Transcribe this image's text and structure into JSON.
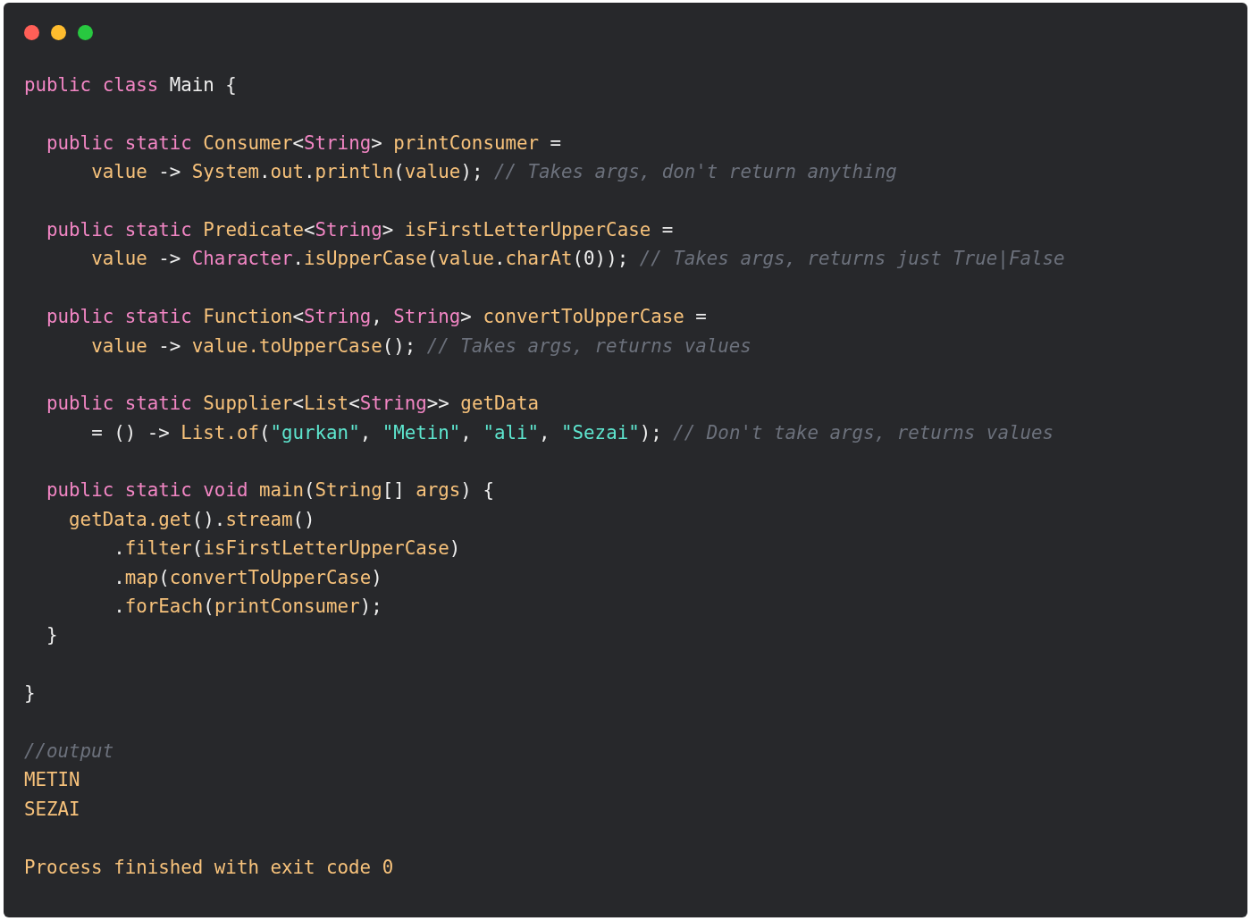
{
  "window": {
    "controls": [
      {
        "color": "#ff5f57"
      },
      {
        "color": "#febc2e"
      },
      {
        "color": "#28c840"
      }
    ]
  },
  "lines": [
    {
      "kind": "code",
      "tokens": [
        {
          "kind": "keyword",
          "text": "public class"
        },
        {
          "kind": "plain",
          "text": " Main {"
        }
      ]
    },
    {
      "kind": "blank"
    },
    {
      "kind": "code",
      "tokens": [
        {
          "kind": "keyword",
          "text": "  public static"
        },
        {
          "kind": "ident",
          "text": " Consumer"
        },
        {
          "kind": "plain",
          "text": "<"
        },
        {
          "kind": "keyword",
          "text": "String"
        },
        {
          "kind": "plain",
          "text": "> "
        },
        {
          "kind": "ident",
          "text": "printConsumer"
        },
        {
          "kind": "plain",
          "text": " ="
        }
      ]
    },
    {
      "kind": "code",
      "tokens": [
        {
          "kind": "ident",
          "text": "      value"
        },
        {
          "kind": "plain",
          "text": " -> "
        },
        {
          "kind": "ident",
          "text": "System"
        },
        {
          "kind": "plain",
          "text": "."
        },
        {
          "kind": "ident",
          "text": "out"
        },
        {
          "kind": "plain",
          "text": "."
        },
        {
          "kind": "ident",
          "text": "println"
        },
        {
          "kind": "plain",
          "text": "("
        },
        {
          "kind": "ident",
          "text": "value"
        },
        {
          "kind": "plain",
          "text": "); "
        },
        {
          "kind": "comment",
          "text": "// Takes args, don't return anything"
        }
      ]
    },
    {
      "kind": "blank"
    },
    {
      "kind": "code",
      "tokens": [
        {
          "kind": "keyword",
          "text": "  public static"
        },
        {
          "kind": "ident",
          "text": " Predicate"
        },
        {
          "kind": "plain",
          "text": "<"
        },
        {
          "kind": "keyword",
          "text": "String"
        },
        {
          "kind": "plain",
          "text": "> "
        },
        {
          "kind": "ident",
          "text": "isFirstLetterUpperCase"
        },
        {
          "kind": "plain",
          "text": " ="
        }
      ]
    },
    {
      "kind": "code",
      "tokens": [
        {
          "kind": "ident",
          "text": "      value"
        },
        {
          "kind": "plain",
          "text": " -> "
        },
        {
          "kind": "keyword",
          "text": "Character"
        },
        {
          "kind": "plain",
          "text": "."
        },
        {
          "kind": "ident",
          "text": "isUpperCase"
        },
        {
          "kind": "plain",
          "text": "("
        },
        {
          "kind": "ident",
          "text": "value"
        },
        {
          "kind": "plain",
          "text": "."
        },
        {
          "kind": "ident",
          "text": "charAt"
        },
        {
          "kind": "plain",
          "text": "(0)); "
        },
        {
          "kind": "comment",
          "text": "// Takes args, returns just True|False"
        }
      ]
    },
    {
      "kind": "blank"
    },
    {
      "kind": "code",
      "tokens": [
        {
          "kind": "keyword",
          "text": "  public static"
        },
        {
          "kind": "ident",
          "text": " Function"
        },
        {
          "kind": "plain",
          "text": "<"
        },
        {
          "kind": "keyword",
          "text": "String"
        },
        {
          "kind": "plain",
          "text": ", "
        },
        {
          "kind": "keyword",
          "text": "String"
        },
        {
          "kind": "plain",
          "text": "> "
        },
        {
          "kind": "ident",
          "text": "convertToUpperCase"
        },
        {
          "kind": "plain",
          "text": " ="
        }
      ]
    },
    {
      "kind": "code",
      "tokens": [
        {
          "kind": "ident",
          "text": "      value"
        },
        {
          "kind": "plain",
          "text": " -> "
        },
        {
          "kind": "ident",
          "text": "value.toUpperCase"
        },
        {
          "kind": "plain",
          "text": "(); "
        },
        {
          "kind": "comment",
          "text": "// Takes args, returns values"
        }
      ]
    },
    {
      "kind": "blank"
    },
    {
      "kind": "code",
      "tokens": [
        {
          "kind": "keyword",
          "text": "  public static"
        },
        {
          "kind": "ident",
          "text": " Supplier"
        },
        {
          "kind": "plain",
          "text": "<"
        },
        {
          "kind": "ident",
          "text": "List"
        },
        {
          "kind": "plain",
          "text": "<"
        },
        {
          "kind": "keyword",
          "text": "String"
        },
        {
          "kind": "plain",
          "text": ">> "
        },
        {
          "kind": "ident",
          "text": "getData"
        }
      ]
    },
    {
      "kind": "code",
      "tokens": [
        {
          "kind": "plain",
          "text": "      = () -> "
        },
        {
          "kind": "ident",
          "text": "List.of"
        },
        {
          "kind": "plain",
          "text": "("
        },
        {
          "kind": "string",
          "text": "\"gurkan\""
        },
        {
          "kind": "plain",
          "text": ", "
        },
        {
          "kind": "string",
          "text": "\"Metin\""
        },
        {
          "kind": "plain",
          "text": ", "
        },
        {
          "kind": "string",
          "text": "\"ali\""
        },
        {
          "kind": "plain",
          "text": ", "
        },
        {
          "kind": "string",
          "text": "\"Sezai\""
        },
        {
          "kind": "plain",
          "text": "); "
        },
        {
          "kind": "comment",
          "text": "// Don't take args, returns values"
        }
      ]
    },
    {
      "kind": "blank"
    },
    {
      "kind": "code",
      "tokens": [
        {
          "kind": "keyword",
          "text": "  public static void"
        },
        {
          "kind": "ident",
          "text": " main"
        },
        {
          "kind": "plain",
          "text": "("
        },
        {
          "kind": "ident",
          "text": "String"
        },
        {
          "kind": "plain",
          "text": "[] "
        },
        {
          "kind": "ident",
          "text": "args"
        },
        {
          "kind": "plain",
          "text": ") {"
        }
      ]
    },
    {
      "kind": "code",
      "tokens": [
        {
          "kind": "ident",
          "text": "    getData.get"
        },
        {
          "kind": "plain",
          "text": "()."
        },
        {
          "kind": "ident",
          "text": "stream"
        },
        {
          "kind": "plain",
          "text": "()"
        }
      ]
    },
    {
      "kind": "code",
      "tokens": [
        {
          "kind": "plain",
          "text": "        ."
        },
        {
          "kind": "ident",
          "text": "filter"
        },
        {
          "kind": "plain",
          "text": "("
        },
        {
          "kind": "ident",
          "text": "isFirstLetterUpperCase"
        },
        {
          "kind": "plain",
          "text": ")"
        }
      ]
    },
    {
      "kind": "code",
      "tokens": [
        {
          "kind": "plain",
          "text": "        ."
        },
        {
          "kind": "ident",
          "text": "map"
        },
        {
          "kind": "plain",
          "text": "("
        },
        {
          "kind": "ident",
          "text": "convertToUpperCase"
        },
        {
          "kind": "plain",
          "text": ")"
        }
      ]
    },
    {
      "kind": "code",
      "tokens": [
        {
          "kind": "plain",
          "text": "        ."
        },
        {
          "kind": "ident",
          "text": "forEach"
        },
        {
          "kind": "plain",
          "text": "("
        },
        {
          "kind": "ident",
          "text": "printConsumer"
        },
        {
          "kind": "plain",
          "text": ");"
        }
      ]
    },
    {
      "kind": "code",
      "tokens": [
        {
          "kind": "plain",
          "text": "  }"
        }
      ]
    },
    {
      "kind": "blank"
    },
    {
      "kind": "code",
      "tokens": [
        {
          "kind": "plain",
          "text": "}"
        }
      ]
    },
    {
      "kind": "blank"
    },
    {
      "kind": "code",
      "tokens": [
        {
          "kind": "comment",
          "text": "//output"
        }
      ]
    },
    {
      "kind": "code",
      "tokens": [
        {
          "kind": "ident",
          "text": "METIN"
        }
      ]
    },
    {
      "kind": "code",
      "tokens": [
        {
          "kind": "ident",
          "text": "SEZAI"
        }
      ]
    },
    {
      "kind": "blank"
    },
    {
      "kind": "code",
      "tokens": [
        {
          "kind": "ident",
          "text": "Process finished with exit code 0"
        }
      ]
    }
  ]
}
